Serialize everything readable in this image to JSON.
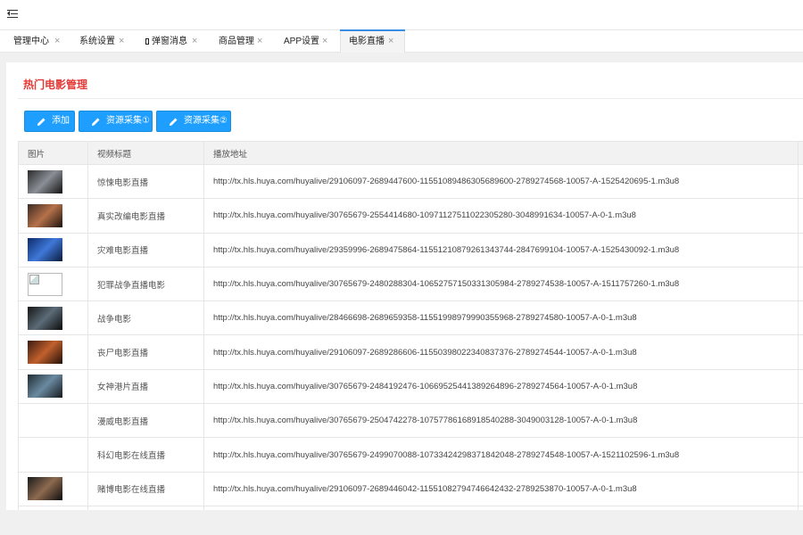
{
  "topbar": {
    "menu_icon": "menu-fold-icon"
  },
  "tabs": [
    {
      "label": "管理中心",
      "active": false
    },
    {
      "label": "系统设置",
      "active": false
    },
    {
      "label": "弹窗消息",
      "active": false
    },
    {
      "label": "商品管理",
      "active": false
    },
    {
      "label": "APP设置",
      "active": false
    },
    {
      "label": "电影直播",
      "active": true
    }
  ],
  "tab_close_glyph": "×",
  "panel": {
    "title": "热门电影管理",
    "buttons": [
      {
        "label": "添加",
        "icon": "pencil-icon"
      },
      {
        "label": "资源采集①",
        "icon": "pencil-icon"
      },
      {
        "label": "资源采集②",
        "icon": "pencil-icon"
      }
    ]
  },
  "table": {
    "headers": [
      "图片",
      "视频标题",
      "播放地址",
      ""
    ],
    "rows": [
      {
        "image": "photo",
        "title": "惊悚电影直播",
        "url": "http://tx.hls.huya.com/huyalive/29106097-2689447600-11551089486305689600-2789274568-10057-A-1525420695-1.m3u8"
      },
      {
        "image": "photo",
        "title": "真实改编电影直播",
        "url": "http://tx.hls.huya.com/huyalive/30765679-2554414680-10971127511022305280-3048991634-10057-A-0-1.m3u8"
      },
      {
        "image": "photo",
        "title": "灾难电影直播",
        "url": "http://tx.hls.huya.com/huyalive/29359996-2689475864-11551210879261343744-2847699104-10057-A-1525430092-1.m3u8"
      },
      {
        "image": "broken",
        "title": "犯罪战争直播电影",
        "url": "http://tx.hls.huya.com/huyalive/30765679-2480288304-10652757150331305984-2789274538-10057-A-1511757260-1.m3u8"
      },
      {
        "image": "photo",
        "title": "战争电影",
        "url": "http://tx.hls.huya.com/huyalive/28466698-2689659358-11551998979990355968-2789274580-10057-A-0-1.m3u8"
      },
      {
        "image": "photo",
        "title": "丧尸电影直播",
        "url": "http://tx.hls.huya.com/huyalive/29106097-2689286606-11550398022340837376-2789274544-10057-A-0-1.m3u8"
      },
      {
        "image": "photo",
        "title": "女神港片直播",
        "url": "http://tx.hls.huya.com/huyalive/30765679-2484192476-10669525441389264896-2789274564-10057-A-0-1.m3u8"
      },
      {
        "image": "none",
        "title": "漫威电影直播",
        "url": "http://tx.hls.huya.com/huyalive/30765679-2504742278-10757786168918540288-3049003128-10057-A-0-1.m3u8"
      },
      {
        "image": "none",
        "title": "科幻电影在线直播",
        "url": "http://tx.hls.huya.com/huyalive/30765679-2499070088-10733424298371842048-2789274548-10057-A-1521102596-1.m3u8"
      },
      {
        "image": "photo",
        "title": "赌博电影在线直播",
        "url": "http://tx.hls.huya.com/huyalive/29106097-2689446042-11551082794746642432-2789253870-10057-A-0-1.m3u8"
      },
      {
        "image": "none",
        "title": "",
        "url": ""
      }
    ]
  },
  "colors": {
    "accent": "#1E9FFF",
    "title_red": "#e53935",
    "tab_active_line": "#3a8ee6"
  }
}
